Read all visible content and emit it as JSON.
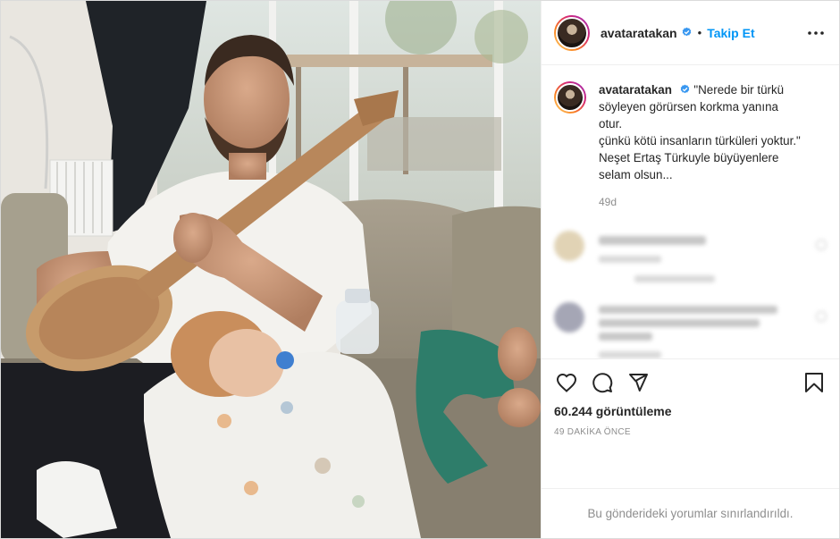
{
  "post": {
    "media_alt": "Video: man playing bağlama on a sofa with a sleeping child",
    "account": {
      "username": "avataratakan",
      "verified": true,
      "follow_label": "Takip Et",
      "separator": "•"
    },
    "caption": {
      "username": "avataratakan",
      "lines": [
        "\"Nerede bir türkü",
        "söyleyen görürsen korkma yanına",
        "otur.",
        "çünkü kötü insanların türküleri yoktur.\"",
        "Neşet Ertaş Türkuyle büyüyenlere",
        "selam olsun..."
      ],
      "time": "49d"
    },
    "stats": {
      "views": "60.244 görüntüleme",
      "time_ago": "49 DAKİKA ÖNCE"
    },
    "comments_restricted": "Bu gönderideki yorumlar sınırlandırıldı.",
    "icons": {
      "more": "more-options-icon",
      "like": "heart-icon",
      "comment": "comment-bubble-icon",
      "share": "paper-plane-icon",
      "save": "bookmark-icon",
      "verified": "verified-badge-icon"
    },
    "colors": {
      "link_blue": "#0095f6",
      "text": "#262626",
      "muted": "#8e8e8e",
      "border": "#dbdbdb"
    }
  }
}
